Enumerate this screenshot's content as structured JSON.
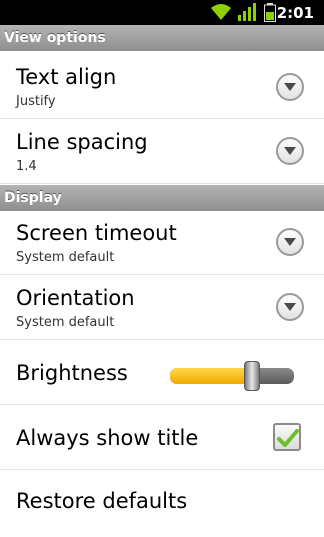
{
  "status_bar": {
    "time": "2:01",
    "icons": [
      "wifi-icon",
      "signal-icon",
      "battery-icon"
    ],
    "accent_color": "#8ed100"
  },
  "sections": {
    "view_options": {
      "label": "View options"
    },
    "display": {
      "label": "Display"
    }
  },
  "settings": {
    "text_align": {
      "title": "Text align",
      "value": "Justify"
    },
    "line_spacing": {
      "title": "Line spacing",
      "value": "1.4"
    },
    "screen_timeout": {
      "title": "Screen timeout",
      "value": "System default"
    },
    "orientation": {
      "title": "Orientation",
      "value": "System default"
    },
    "brightness": {
      "title": "Brightness",
      "level_fraction": 0.66
    },
    "always_show_title": {
      "title": "Always show title",
      "checked": true
    },
    "restore_defaults": {
      "title": "Restore defaults"
    }
  },
  "colors": {
    "slider_fill": "#f5b800",
    "check_mark": "#6bbf2a"
  }
}
